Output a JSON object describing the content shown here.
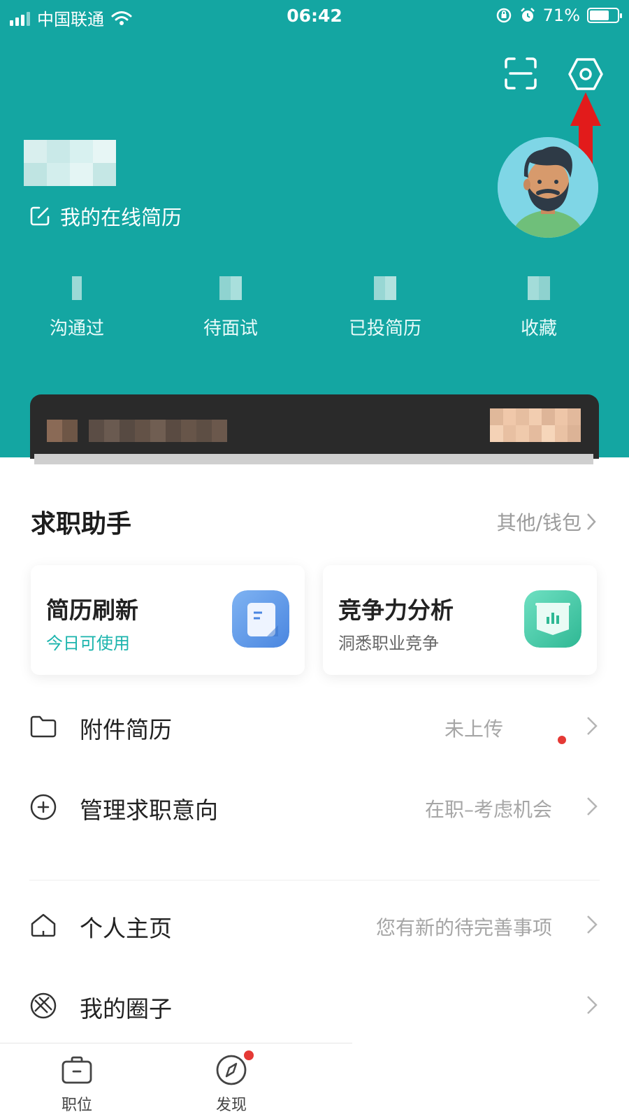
{
  "status_bar": {
    "carrier": "中国联通",
    "time": "06:42",
    "battery_percent": "71%",
    "battery_level": 0.71
  },
  "header": {
    "scan_icon": "scan-icon",
    "settings_icon": "settings-hexagon-icon",
    "resume_link": "我的在线简历",
    "avatar": "avatar-bearded-man",
    "stats": [
      {
        "label": "沟通过"
      },
      {
        "label": "待面试"
      },
      {
        "label": "已投简历"
      },
      {
        "label": "收藏"
      }
    ],
    "accent_color": "#14a6a2"
  },
  "assistant": {
    "title": "求职助手",
    "more_link": "其他/钱包",
    "cards": [
      {
        "title": "简历刷新",
        "subtitle": "今日可使用",
        "icon": "document-icon"
      },
      {
        "title": "竞争力分析",
        "subtitle": "洞悉职业竞争",
        "icon": "chart-flag-icon"
      }
    ]
  },
  "menu": [
    {
      "label": "附件简历",
      "value": "未上传",
      "icon": "folder-icon"
    },
    {
      "label": "管理求职意向",
      "value": "在职–考虑机会",
      "icon": "plus-circle-icon"
    },
    {
      "label": "个人主页",
      "value": "您有新的待完善事项",
      "icon": "home-icon"
    },
    {
      "label": "我的圈子",
      "value": "",
      "icon": "circle-aperture-icon"
    }
  ],
  "tabs": [
    {
      "label": "职位",
      "icon": "briefcase-icon"
    },
    {
      "label": "发现",
      "icon": "compass-icon"
    }
  ]
}
